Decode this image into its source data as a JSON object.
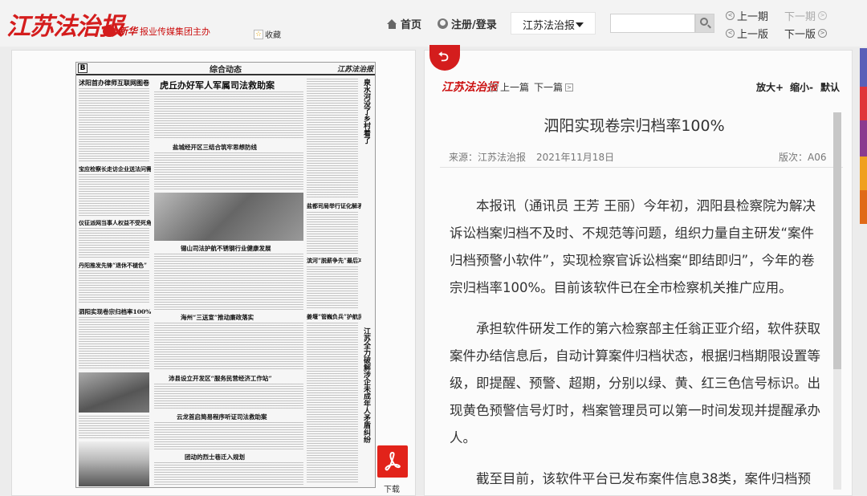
{
  "header": {
    "logo_text": "江苏法治报",
    "sponsor_brand": "新华",
    "sponsor_text": "报业传媒集团主办",
    "favorite_label": "收藏",
    "nav": {
      "home": "首页",
      "login": "注册/登录"
    },
    "paper_select": "江苏法治报",
    "search": {
      "placeholder": ""
    },
    "issue_nav": {
      "prev_issue": "上一期",
      "next_issue": "下一期",
      "prev_page": "上一版",
      "next_page": "下一版"
    }
  },
  "side_tabs": {
    "colors": [
      "#5a5fb8",
      "#e0353a",
      "#8b3a8f",
      "#f0a020",
      "#e06a18"
    ]
  },
  "newspaper": {
    "page_letter": "B",
    "section_title": "综合动态",
    "masthead": "江苏法治报",
    "headlines": [
      "沭阳首办律师互联网图卷",
      "虎丘办好军人军属司法救助案",
      "盐城经开区三结合筑牢思想防线",
      "宝应检察长走访企业送法问需",
      "盐都司局举行证化解矛盾",
      "仪征派网当事人权益不受死角",
      "滨河“脱薪争先”最后冲刺",
      "丹阳推发先锋“退休不褪色”",
      "锡山司法护航不锈钢行业健康发展",
      "泗阳实现卷宗归档率100%",
      "姜堰“管巍负兵”护航民企进一线",
      "海州“三送宣”推动廉政落实",
      "沛县设立开发区“服务民营经济工作站”",
      "云龙首启简易程序听证司法救助案",
      "团动的烈士巷迁入规划"
    ],
    "vertical_heads": [
      "泉水河没了乡村着了",
      "江苏全力破解涉企未成年人矛盾纠纷"
    ]
  },
  "download": {
    "label": "下载"
  },
  "article": {
    "toolbar": {
      "logo": "江苏法治报",
      "prev": "上一篇",
      "next": "下一篇",
      "zoom_in": "放大+",
      "zoom_out": "缩小-",
      "reset": "默认"
    },
    "title": "泗阳实现卷宗归档率100%",
    "source": "来源：江苏法治报",
    "date": "2021年11月18日",
    "edition": "版次：A06",
    "paragraphs": [
      "本报讯（通讯员 王芳 王丽）今年初，泗阳县检察院为解决诉讼档案归档不及时、不规范等问题，组织力量自主研发“案件归档预警小软件”，实现检察官诉讼档案“即结即归”，今年的卷宗归档率100%。目前该软件已在全市检察机关推广应用。",
      "承担软件研发工作的第六检察部主任翁正亚介绍，软件获取案件办结信息后，自动计算案件归档状态，根据归档期限设置等级，即提醒、预警、超期，分别以绿、黄、红三色信号标识。出现黄色预警信号灯时，档案管理员可以第一时间发现并提醒承办人。",
      "截至目前，该软件平台已发布案件信息38类，案件归档预"
    ]
  }
}
